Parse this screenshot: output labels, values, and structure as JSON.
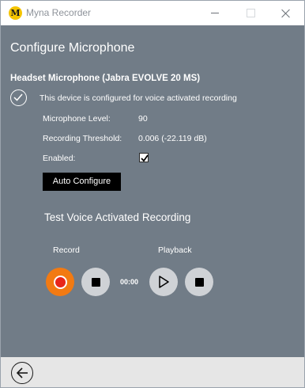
{
  "window": {
    "title": "Myna Recorder",
    "icon_letter": "M",
    "icons": {
      "minimize": "minimize-icon",
      "maximize": "maximize-icon",
      "close": "close-icon"
    }
  },
  "colors": {
    "content_bg": "#717c87",
    "record_accent": "#f27a12",
    "record_dot": "#e8261a",
    "button_dark": "#000000",
    "circle_button": "#cfd2d6",
    "bottom_bar": "#e6e6e6"
  },
  "page": {
    "title": "Configure Microphone",
    "device_name": "Headset Microphone (Jabra EVOLVE 20 MS)",
    "configured_message": "This device is configured for voice activated recording",
    "status_icon": "check-circle-icon"
  },
  "settings": {
    "level_label": "Microphone Level:",
    "level_value": "90",
    "threshold_label": "Recording Threshold:",
    "threshold_value": "0.006 (-22.119 dB)",
    "enabled_label": "Enabled:",
    "enabled": true,
    "auto_configure_label": "Auto Configure"
  },
  "test": {
    "title": "Test Voice Activated Recording",
    "record_label": "Record",
    "playback_label": "Playback",
    "timer": "00:00",
    "icons": {
      "record": "record-icon",
      "stop": "stop-icon",
      "play": "play-icon"
    }
  },
  "bottom": {
    "back_icon": "back-arrow-icon"
  }
}
